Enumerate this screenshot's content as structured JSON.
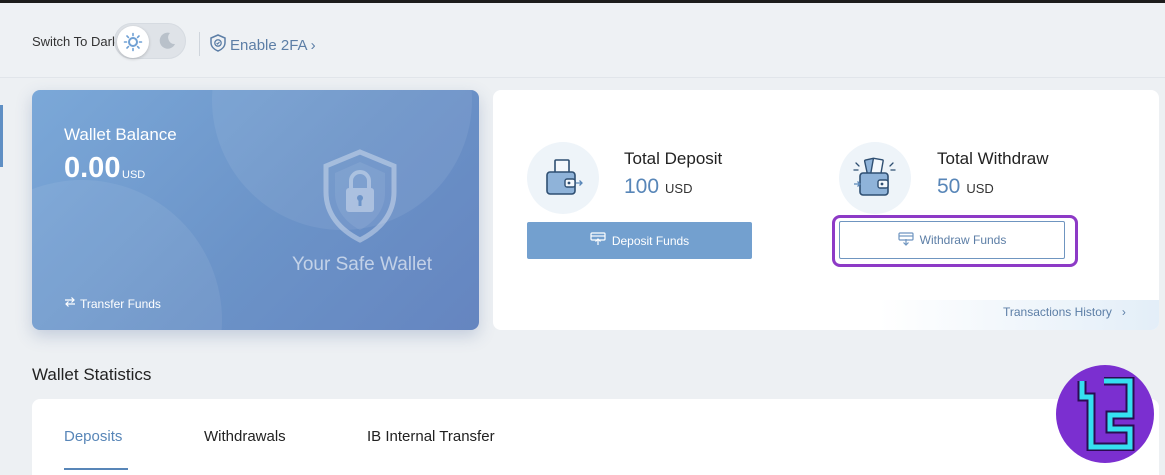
{
  "header": {
    "switch_label": "Switch To Dark",
    "twofa_label": "Enable 2FA",
    "twofa_chevron": "›"
  },
  "wallet": {
    "title": "Wallet Balance",
    "amount": "0.00",
    "currency": "USD",
    "tagline": "Your Safe Wallet",
    "transfer_label": "Transfer Funds"
  },
  "summary": {
    "deposit": {
      "title": "Total Deposit",
      "amount": "100",
      "currency": "USD",
      "button": "Deposit Funds"
    },
    "withdraw": {
      "title": "Total Withdraw",
      "amount": "50",
      "currency": "USD",
      "button": "Withdraw Funds"
    },
    "history_label": "Transactions History",
    "history_chevron": "›"
  },
  "stats": {
    "title": "Wallet Statistics",
    "tabs": [
      {
        "label": "Deposits",
        "active": true
      },
      {
        "label": "Withdrawals",
        "active": false
      },
      {
        "label": "IB Internal Transfer",
        "active": false
      }
    ]
  },
  "colors": {
    "accent": "#5886b8",
    "wallet_gradient_start": "#7ba8d8",
    "wallet_gradient_end": "#6585c0",
    "highlight": "#8d3ac6",
    "brand_logo": "#7b2fd0"
  },
  "icons": [
    "sun-icon",
    "moon-icon",
    "shield-check-icon",
    "shield-lock-icon",
    "transfer-arrows-icon",
    "wallet-deposit-icon",
    "wallet-withdraw-icon",
    "card-deposit-icon",
    "card-withdraw-icon",
    "chevron-right-icon"
  ]
}
